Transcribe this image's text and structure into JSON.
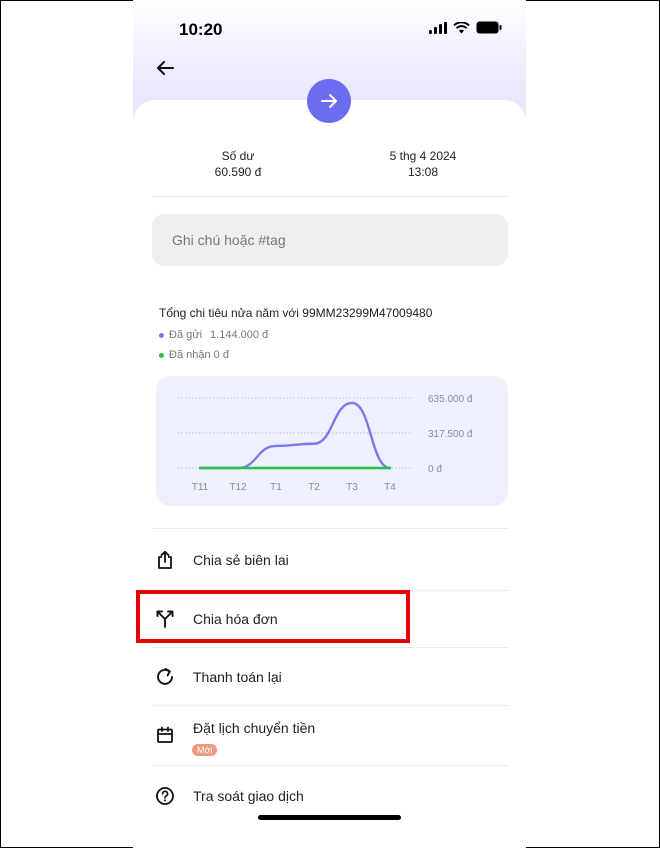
{
  "status_bar": {
    "time": "10:20"
  },
  "balance": {
    "label": "Số dư",
    "value": "60.590 đ"
  },
  "datetime": {
    "date": "5 thg 4 2024",
    "time": "13:08"
  },
  "note": {
    "placeholder": "Ghi chú hoặc #tag"
  },
  "summary": {
    "title": "Tổng chi tiêu nửa năm với 99MM23299M47009480",
    "sent_label": "Đã gửi",
    "sent_value": "1.144.000 đ",
    "received_label": "Đã nhận 0 đ"
  },
  "chart_data": {
    "type": "line",
    "categories": [
      "T11",
      "T12",
      "T1",
      "T2",
      "T3",
      "T4"
    ],
    "y_tick_labels": [
      "635.000 đ",
      "317.500 đ",
      "0 đ"
    ],
    "ylim": [
      0,
      635000
    ],
    "series": [
      {
        "name": "Đã gửi",
        "color": "#7b78ee",
        "values": [
          0,
          0,
          200000,
          220000,
          590000,
          0
        ]
      },
      {
        "name": "Đã nhận",
        "color": "#2bbf4d",
        "values": [
          0,
          0,
          0,
          0,
          0,
          0
        ]
      }
    ],
    "grid": true
  },
  "menu": [
    {
      "label": "Chia sẻ biên lai",
      "icon": "share-icon"
    },
    {
      "label": "Chia hóa đơn",
      "icon": "split-icon"
    },
    {
      "label": "Thanh toán lại",
      "icon": "repeat-icon"
    },
    {
      "label": "Đặt lịch chuyển tiền",
      "icon": "calendar-icon",
      "badge": "Mới"
    },
    {
      "label": "Tra soát giao dịch",
      "icon": "help-icon"
    }
  ],
  "colors": {
    "accent": "#6c6cf0",
    "sent": "#7b78ee",
    "received": "#2bbf4d",
    "highlight": "#e80000",
    "badge": "#ee9a7e"
  }
}
